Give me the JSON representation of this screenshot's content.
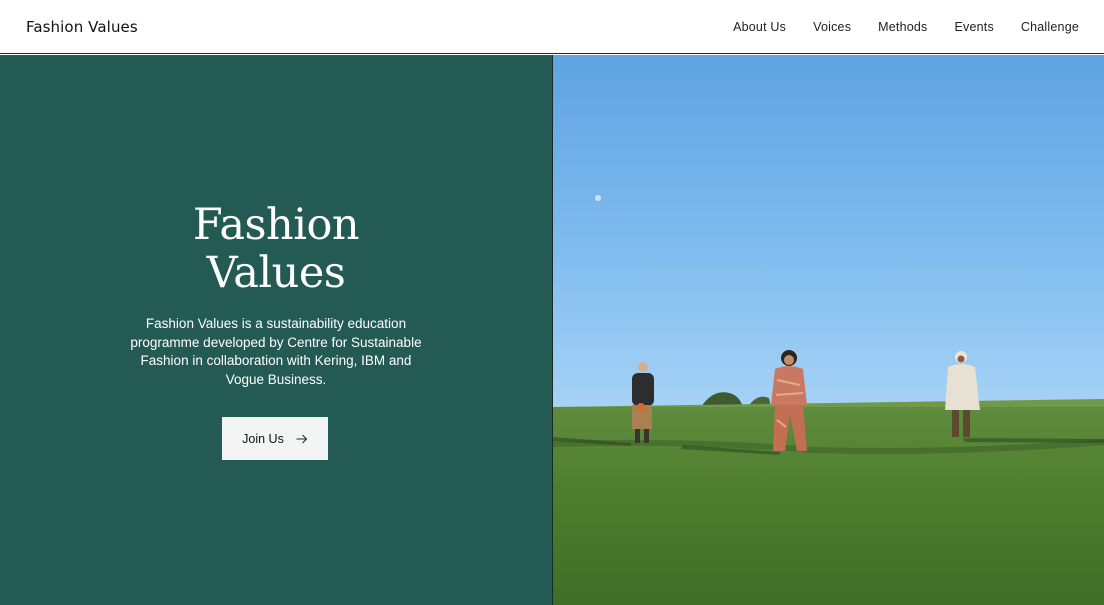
{
  "header": {
    "logo": "Fashion Values",
    "nav": [
      {
        "label": "About Us"
      },
      {
        "label": "Voices"
      },
      {
        "label": "Methods"
      },
      {
        "label": "Events"
      },
      {
        "label": "Challenge"
      }
    ]
  },
  "hero": {
    "title_line1": "Fashion",
    "title_line2": "Values",
    "description": "Fashion Values is a sustainability education programme developed by Centre for Sustainable Fashion in collaboration with Kering, IBM and Vogue Business.",
    "button_label": "Join Us",
    "button_icon": "arrow-right-icon",
    "image_subject": "Three people standing in a green field under a blue sky"
  },
  "colors": {
    "hero_panel": "#235a54",
    "button_bg": "#f3f5f5",
    "text_light": "#ffffff",
    "text_dark": "#111111"
  }
}
